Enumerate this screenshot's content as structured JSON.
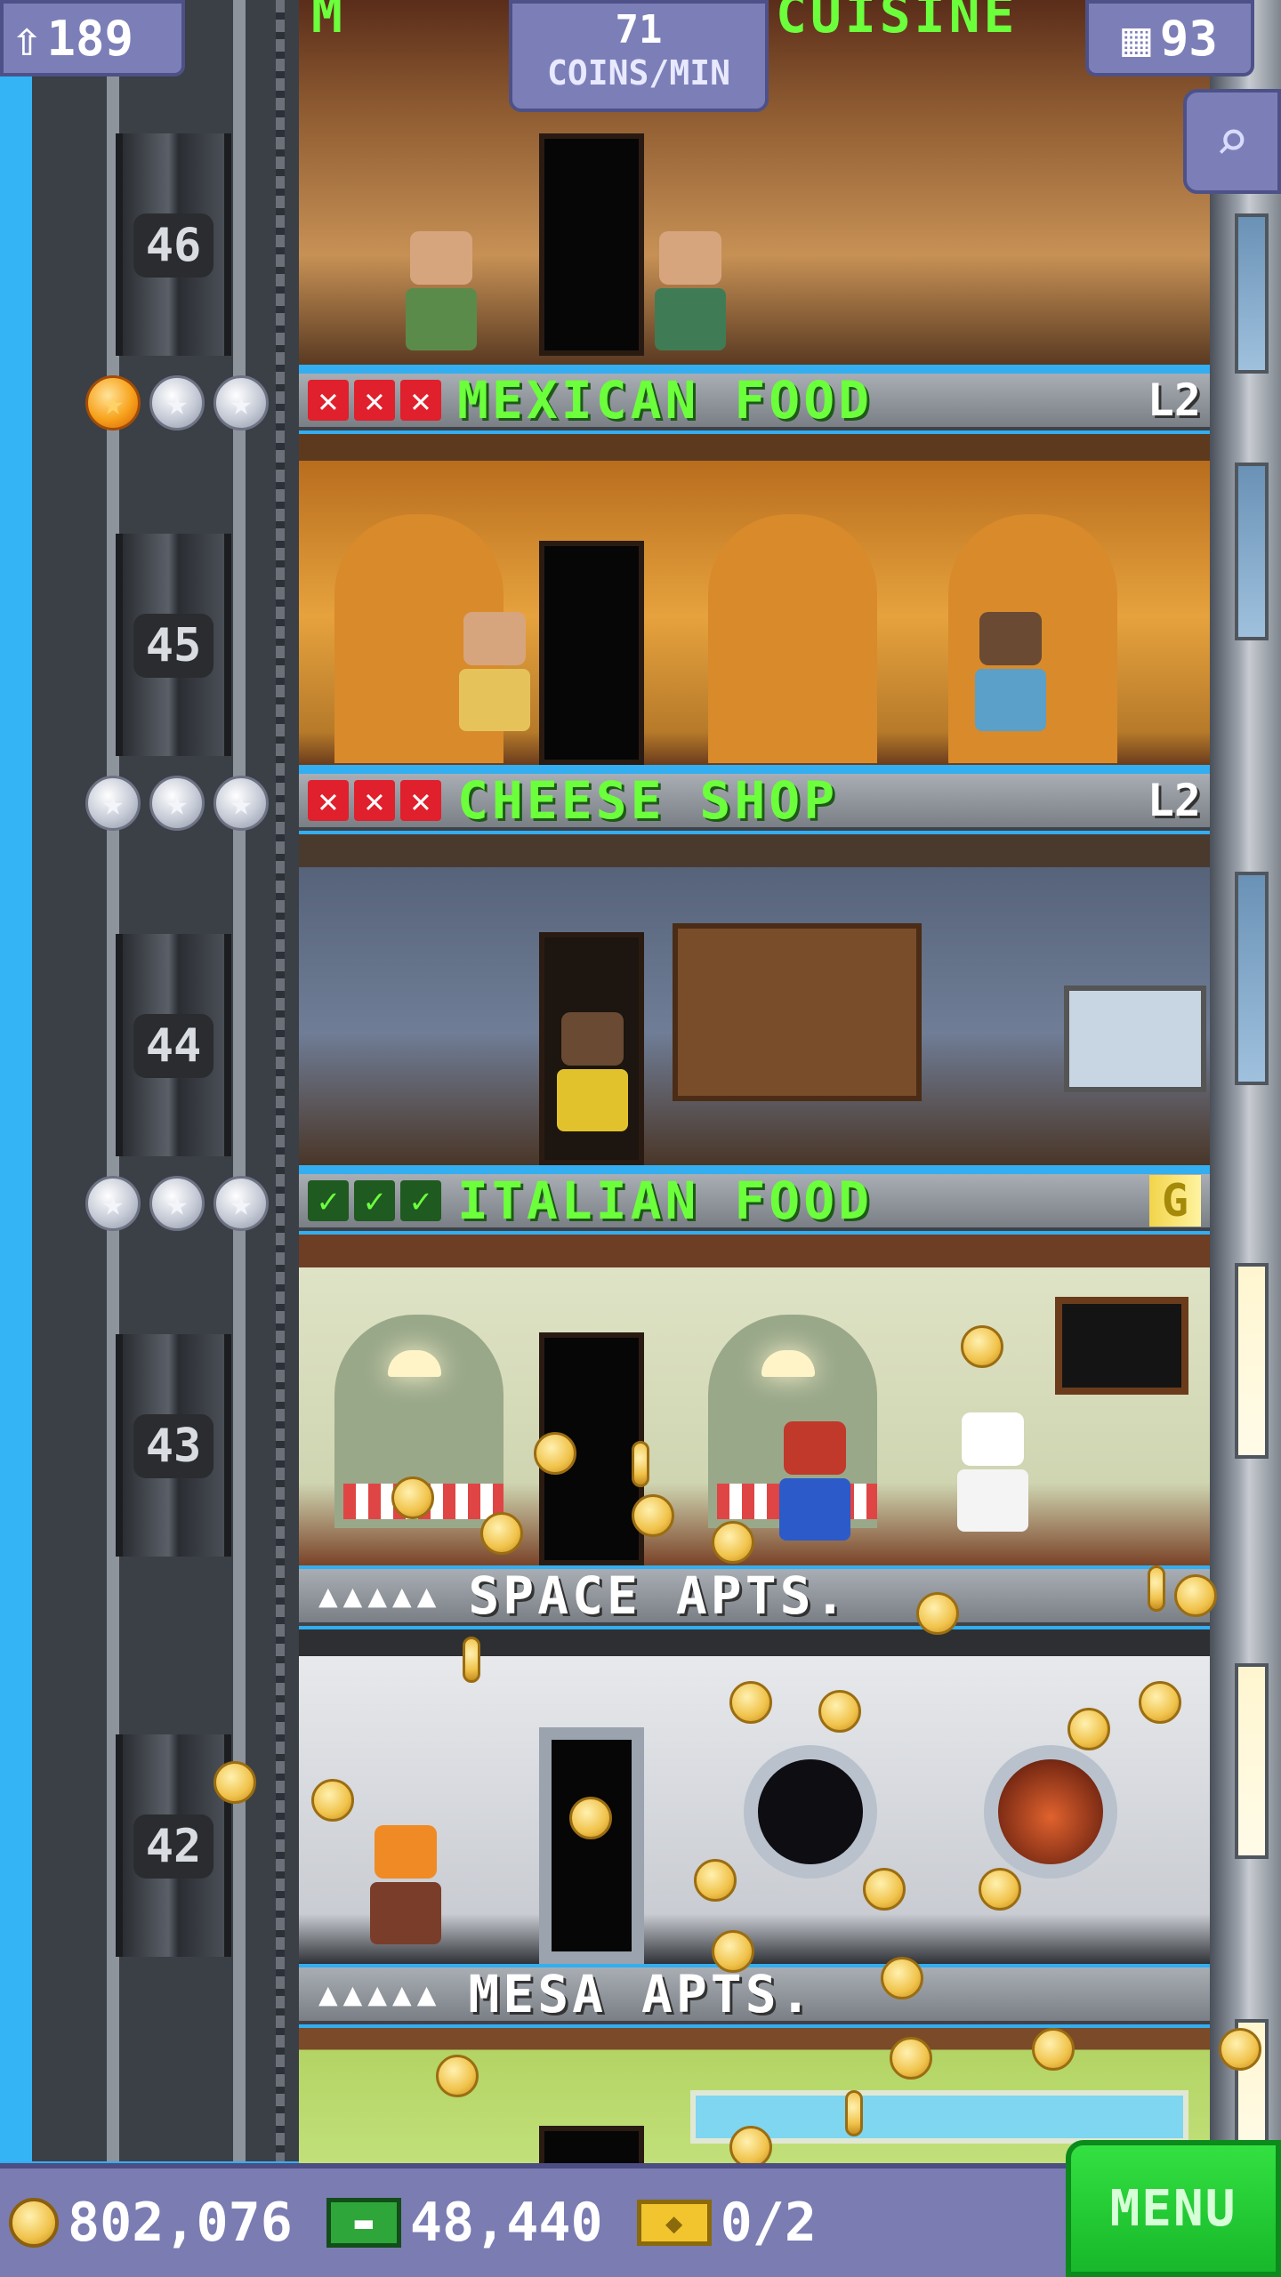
{
  "hud": {
    "population": "189",
    "coin_rate_value": "71",
    "coin_rate_unit": "COINS/MIN",
    "floor_count": "93"
  },
  "top_floor": {
    "label_left": "M",
    "label_right": "CUISINE"
  },
  "floors": [
    {
      "number": "46",
      "name": "MEXICAN FOOD",
      "level": "L2",
      "stars": [
        "filled",
        "empty",
        "empty"
      ],
      "status": [
        "x",
        "x",
        "x"
      ]
    },
    {
      "number": "45",
      "name": "CHEESE SHOP",
      "level": "L2",
      "stars": [
        "empty",
        "empty",
        "empty"
      ],
      "status": [
        "x",
        "x",
        "x"
      ]
    },
    {
      "number": "44",
      "name": "ITALIAN FOOD",
      "level": "G",
      "stars": [
        "empty",
        "empty",
        "empty"
      ],
      "status": [
        "check",
        "check",
        "check"
      ]
    },
    {
      "number": "43",
      "name": "SPACE APTS.",
      "residents": "▲▲▲▲▲"
    },
    {
      "number": "42",
      "name": "MESA APTS.",
      "residents": "▲▲▲▲▲"
    }
  ],
  "bottom_bar": {
    "coins": "802,076",
    "bux": "48,440",
    "tickets": "0/2",
    "menu_label": "MENU"
  },
  "icons": {
    "population": "person-up-icon",
    "floors": "building-icon",
    "zoom": "zoom-out-icon"
  },
  "colors": {
    "hud_bg": "#7c7fb7",
    "floor_title": "#6cff3c",
    "menu_green": "#17b82a",
    "status_fail": "#e0202c"
  }
}
